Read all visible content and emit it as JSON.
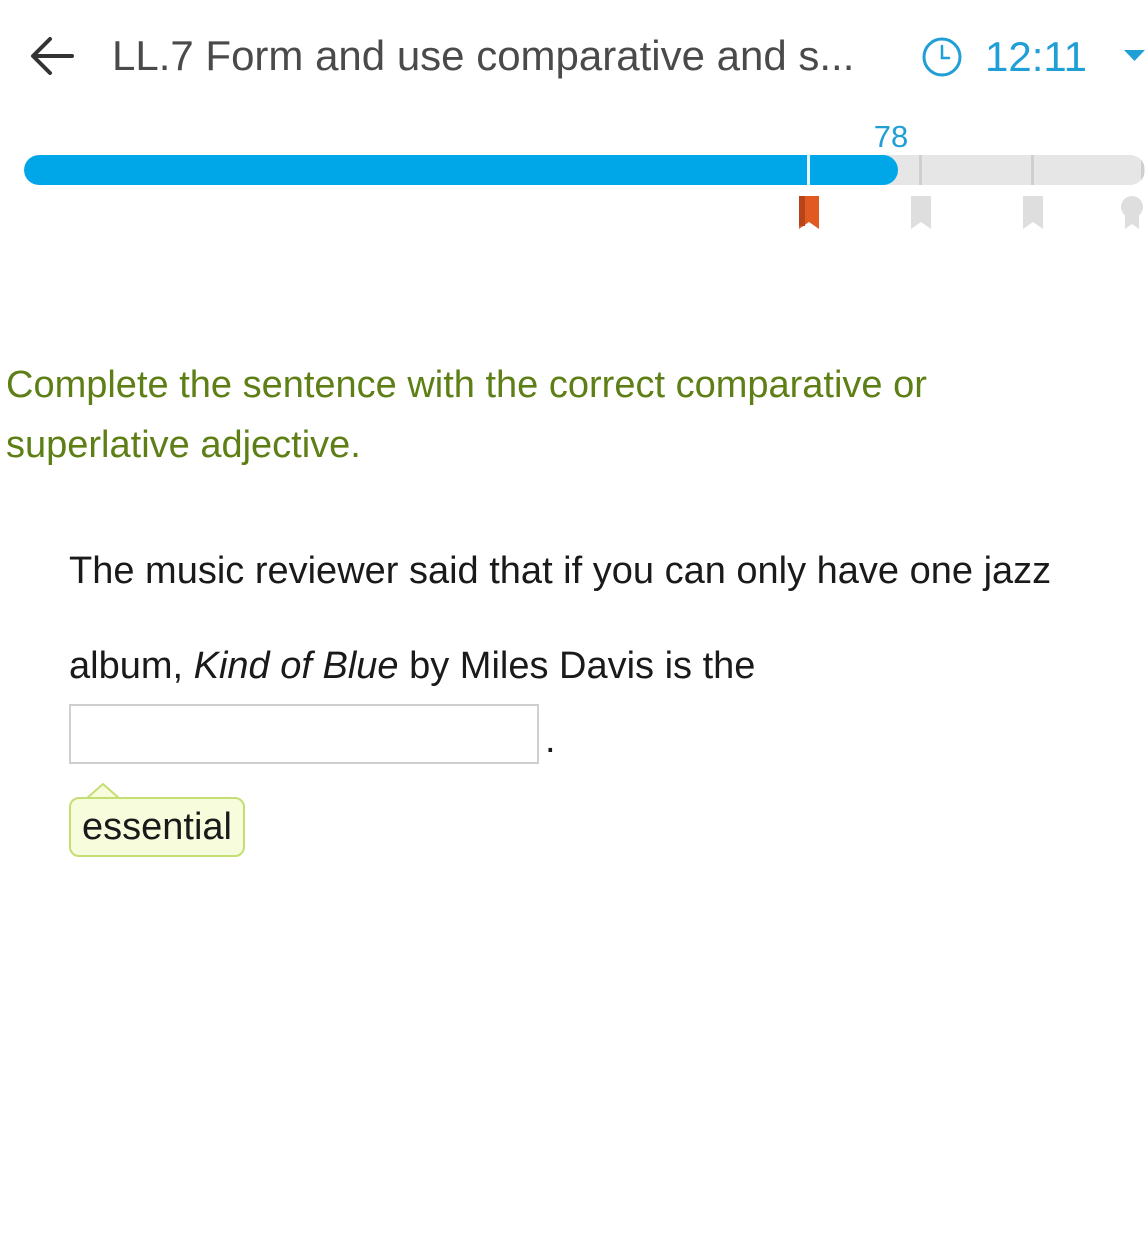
{
  "header": {
    "back_icon": "arrow-left-icon",
    "title": "LL.7 Form and use comparative and s...",
    "clock_icon": "clock-icon",
    "time": "12:11",
    "menu_icon": "caret-down-icon"
  },
  "progress": {
    "score": "78",
    "max_score": 100,
    "milestones": [
      70,
      80,
      90,
      100
    ],
    "milestone_reached": 70,
    "colors": {
      "fill": "#00a7e8",
      "track": "#e6e6e6",
      "reached_marker": "#e05a22",
      "pending_marker": "#dedede"
    }
  },
  "question": {
    "instructions": "Complete the sentence with the correct comparative or superlative adjective.",
    "sentence_part1": "The music reviewer said that if you can only have one jazz album, ",
    "sentence_italic": "Kind of Blue",
    "sentence_part2": " by Miles Davis is the",
    "answer_value": "",
    "period": ".",
    "hint_word": "essential"
  },
  "colors": {
    "accent": "#1f9fd6",
    "instructions": "#5e7e16",
    "hint_border": "#c4de73",
    "hint_background": "#f7fcdc"
  }
}
